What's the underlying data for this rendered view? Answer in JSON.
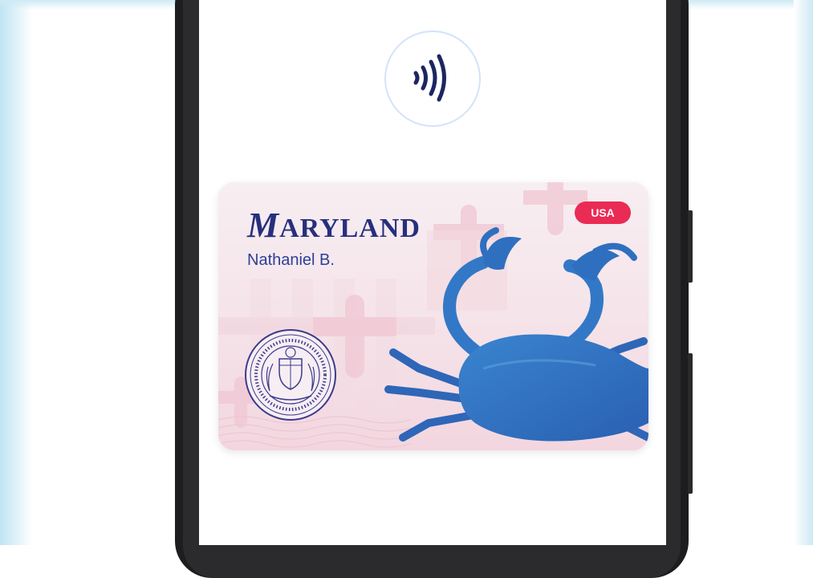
{
  "card": {
    "state_first_letter": "M",
    "state_rest": "ARYLAND",
    "holder_name": "Nathaniel B.",
    "country_badge": "USA"
  },
  "colors": {
    "background": "#ffffff",
    "phone_frame": "#1d1d1f",
    "nfc_ring": "#d3e3fb",
    "nfc_icon": "#1c2660",
    "card_background": "#f6e9ee",
    "state_name": "#272f7c",
    "holder_name": "#2d3f98",
    "badge": "#ea2b54",
    "crab": "#2f6fbf",
    "seal": "#3d3a8c"
  },
  "icons": {
    "contactless": "contactless-icon",
    "seal": "state-seal-icon",
    "crab": "blue-crab-illustration"
  }
}
